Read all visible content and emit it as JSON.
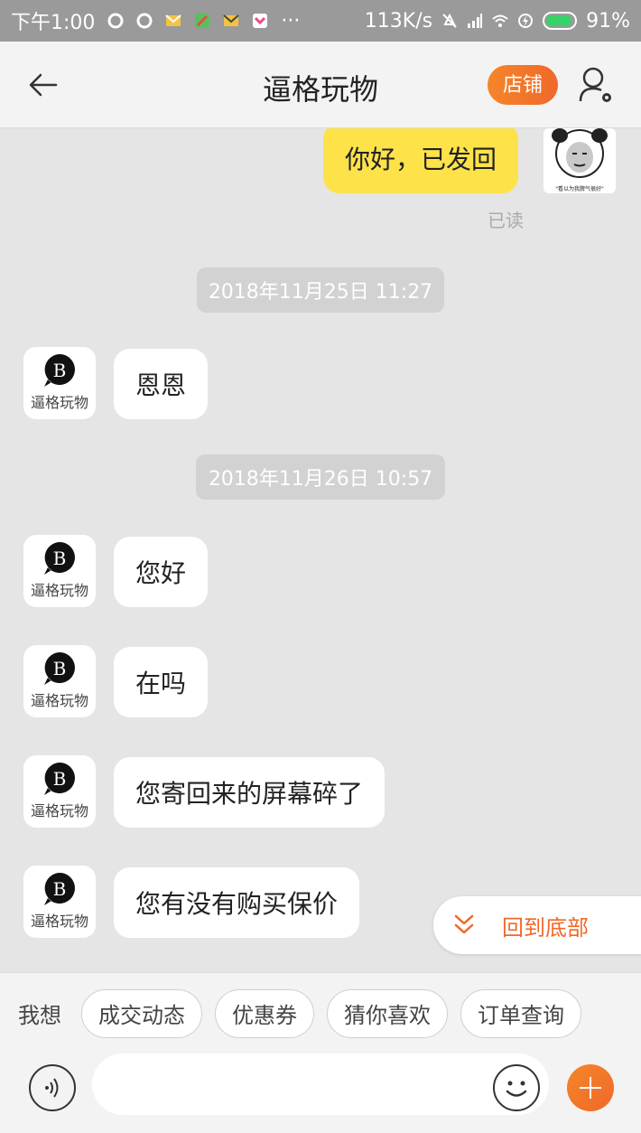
{
  "status_bar": {
    "time": "下午1:00",
    "net_speed": "113K/s",
    "battery": "91%"
  },
  "header": {
    "title": "逼格玩物",
    "shop_button": "店铺"
  },
  "messages": {
    "my_last": "你好，已发回",
    "read_label": "已读",
    "my_avatar_caption": "\"看以为我脾气很好\"",
    "stamp1": "2018年11月25日 11:27",
    "seller1": "恩恩",
    "stamp2": "2018年11月26日 10:57",
    "seller2": "您好",
    "seller3": "在吗",
    "seller4": "您寄回来的屏幕碎了",
    "seller5": "您有没有购买保价"
  },
  "seller_avatar_label": "逼格玩物",
  "back_to_bottom": "回到底部",
  "quick": {
    "label": "我想",
    "chips": [
      "成交动态",
      "优惠券",
      "猜你喜欢",
      "订单查询"
    ]
  },
  "colors": {
    "accent": "#f0682a",
    "my_bubble": "#fde24a",
    "chat_bg": "#e5e5e5"
  }
}
